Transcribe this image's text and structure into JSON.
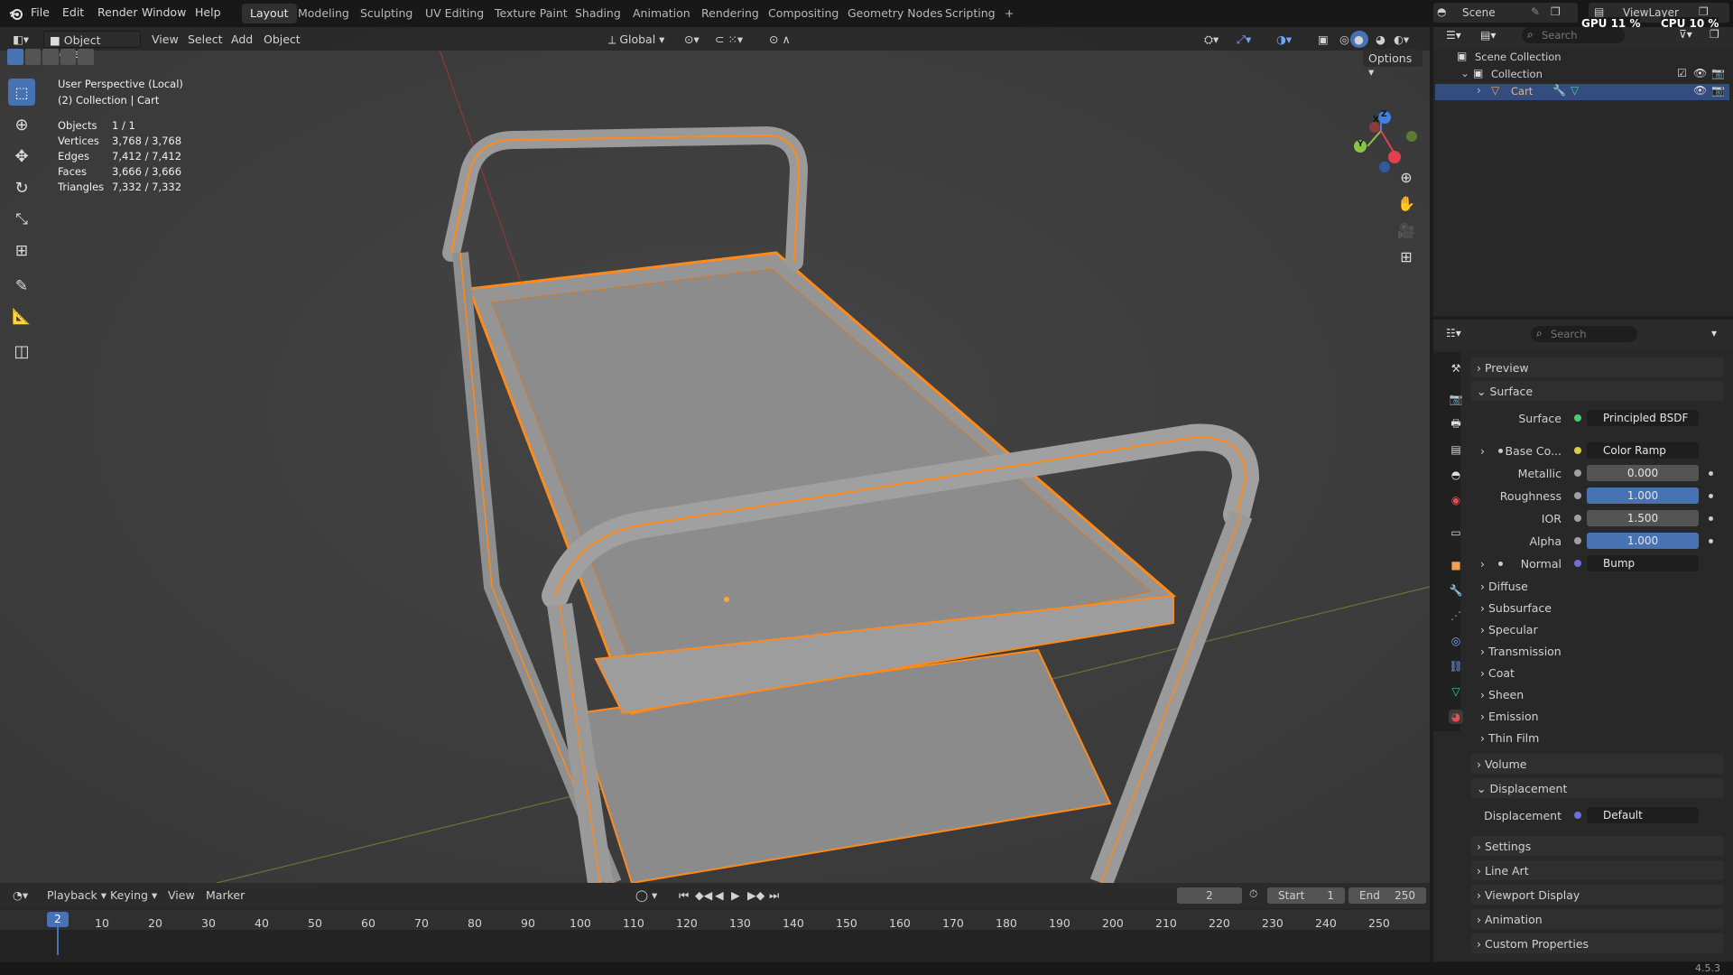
{
  "topbar": {
    "menus": [
      "File",
      "Edit",
      "Render",
      "Window",
      "Help"
    ],
    "workspaces": [
      "Layout",
      "Modeling",
      "Sculpting",
      "UV Editing",
      "Texture Paint",
      "Shading",
      "Animation",
      "Rendering",
      "Compositing",
      "Geometry Nodes",
      "Scripting"
    ],
    "active_workspace": "Layout",
    "add_tab": "+",
    "scene_label": "Scene",
    "viewlayer_label": "ViewLayer",
    "gpu": "GPU 11 %",
    "cpu": "CPU 10 %"
  },
  "viewport_header": {
    "mode": "Object Mode",
    "menus": [
      "View",
      "Select",
      "Add",
      "Object"
    ],
    "orientation": "Global",
    "options": "Options"
  },
  "overlay": {
    "view_name": "User Perspective (Local)",
    "collection": "(2) Collection | Cart",
    "stats": [
      {
        "label": "Objects",
        "value": "1 / 1"
      },
      {
        "label": "Vertices",
        "value": "3,768 / 3,768"
      },
      {
        "label": "Edges",
        "value": "7,412 / 7,412"
      },
      {
        "label": "Faces",
        "value": "3,666 / 3,666"
      },
      {
        "label": "Triangles",
        "value": "7,332 / 7,332"
      }
    ],
    "gizmo_axes": {
      "x": "X",
      "y": "Y",
      "z": "Z"
    }
  },
  "outliner": {
    "search_placeholder": "Search",
    "scene_collection": "Scene Collection",
    "collection": "Collection",
    "object": "Cart"
  },
  "properties": {
    "search_placeholder": "Search",
    "sections": {
      "preview": "Preview",
      "surface": "Surface",
      "volume": "Volume",
      "displacement": "Displacement",
      "settings": "Settings",
      "line_art": "Line Art",
      "viewport_display": "Viewport Display",
      "animation": "Animation",
      "custom_properties": "Custom Properties"
    },
    "surface_label": "Surface",
    "surface_value": "Principled BSDF",
    "base_color_label": "Base Co...",
    "base_color_value": "Color Ramp",
    "metallic_label": "Metallic",
    "metallic_value": "0.000",
    "roughness_label": "Roughness",
    "roughness_value": "1.000",
    "ior_label": "IOR",
    "ior_value": "1.500",
    "alpha_label": "Alpha",
    "alpha_value": "1.000",
    "normal_label": "Normal",
    "normal_value": "Bump",
    "subpanels": [
      "Diffuse",
      "Subsurface",
      "Specular",
      "Transmission",
      "Coat",
      "Sheen",
      "Emission",
      "Thin Film"
    ],
    "displacement_label": "Displacement",
    "displacement_value": "Default"
  },
  "timeline": {
    "menus": [
      "Playback",
      "Keying",
      "View",
      "Marker"
    ],
    "current_frame": "2",
    "start_label": "Start",
    "start_value": "1",
    "end_label": "End",
    "end_value": "250",
    "ticks": [
      "10",
      "20",
      "30",
      "40",
      "50",
      "60",
      "70",
      "80",
      "90",
      "100",
      "110",
      "120",
      "130",
      "140",
      "150",
      "160",
      "170",
      "180",
      "190",
      "200",
      "210",
      "220",
      "230",
      "240",
      "250"
    ],
    "frame_marker": "2"
  },
  "statusbar": {
    "version": "4.5.3"
  },
  "colors": {
    "accent": "#4772b3",
    "selection": "#ff8a1a",
    "xaxis": "#e04050",
    "yaxis": "#8bc34a",
    "zaxis": "#3f80e0"
  }
}
